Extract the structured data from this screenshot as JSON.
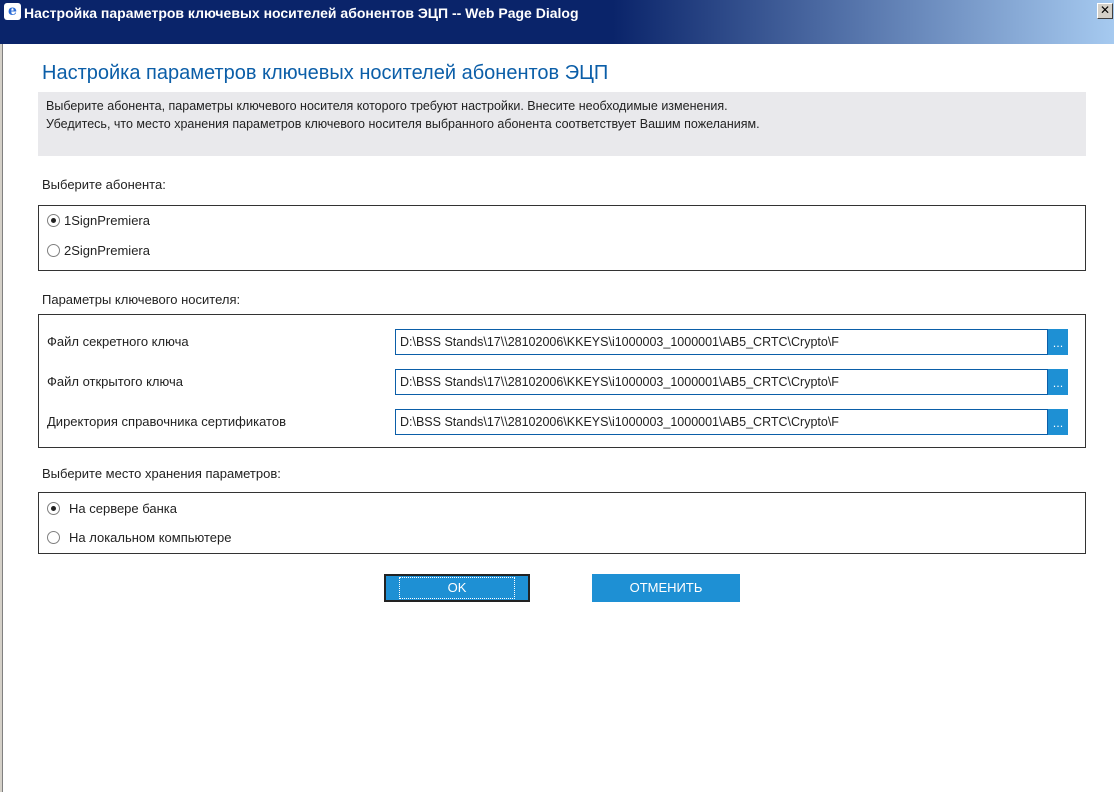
{
  "window": {
    "title": "Настройка параметров ключевых носителей абонентов ЭЦП -- Web Page Dialog",
    "close_glyph": "✕",
    "browser_icon": "ie-icon"
  },
  "heading": "Настройка параметров ключевых носителей абонентов ЭЦП",
  "info": {
    "line1": "Выберите абонента, параметры ключевого носителя которого требуют настройки. Внесите необходимые изменения.",
    "line2": "Убедитесь, что место хранения параметров ключевого носителя выбранного абонента соответствует Вашим пожеланиям."
  },
  "subscriber": {
    "label": "Выберите абонента:",
    "options": [
      {
        "label": "1SignPremiera",
        "checked": true
      },
      {
        "label": "2SignPremiera",
        "checked": false
      }
    ]
  },
  "params": {
    "label": "Параметры ключевого носителя:",
    "rows": [
      {
        "label": "Файл секретного ключа",
        "value": "D:\\BSS Stands\\17\\\\28102006\\KKEYS\\i1000003_1000001\\AB5_CRTC\\Crypto\\F",
        "button": "..."
      },
      {
        "label": "Файл открытого ключа",
        "value": "D:\\BSS Stands\\17\\\\28102006\\KKEYS\\i1000003_1000001\\AB5_CRTC\\Crypto\\F",
        "button": "..."
      },
      {
        "label": "Директория справочника сертификатов",
        "value": "D:\\BSS Stands\\17\\\\28102006\\KKEYS\\i1000003_1000001\\AB5_CRTC\\Crypto\\F",
        "button": "..."
      }
    ]
  },
  "storage": {
    "label": "Выберите место хранения параметров:",
    "options": [
      {
        "label": "На сервере банка",
        "checked": true
      },
      {
        "label": "На локальном компьютере",
        "checked": false
      }
    ]
  },
  "buttons": {
    "ok": "OK",
    "cancel": "ОТМЕНИТЬ"
  },
  "colors": {
    "heading": "#0b5ea8",
    "button": "#1e90d4",
    "titlebar": "#0a246a"
  }
}
